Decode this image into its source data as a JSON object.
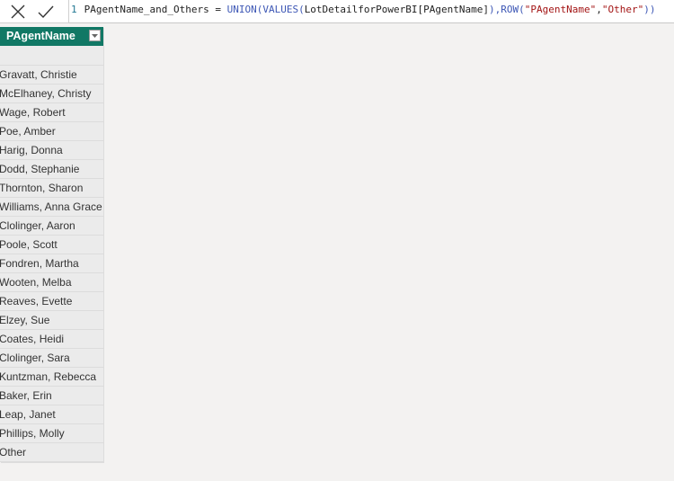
{
  "formula_bar": {
    "cancel_icon": "close-icon",
    "commit_icon": "check-icon",
    "line_number": "1",
    "tokens": [
      {
        "text": "PAgentName_and_Others = ",
        "kind": "plain"
      },
      {
        "text": "UNION(",
        "kind": "kw"
      },
      {
        "text": "VALUES(",
        "kind": "kw"
      },
      {
        "text": "LotDetailforPowerBI[PAgentName]",
        "kind": "plain"
      },
      {
        "text": "),",
        "kind": "kw"
      },
      {
        "text": "ROW(",
        "kind": "kw"
      },
      {
        "text": "\"PAgentName\"",
        "kind": "str"
      },
      {
        "text": ",",
        "kind": "plain"
      },
      {
        "text": "\"Other\"",
        "kind": "str"
      },
      {
        "text": "))",
        "kind": "kw"
      }
    ]
  },
  "table": {
    "header": "PAgentName",
    "header_color": "#117865",
    "filter_icon": "dropdown-filter-icon",
    "rows": [
      "",
      "Gravatt, Christie",
      "McElhaney, Christy",
      "Wage, Robert",
      "Poe, Amber",
      "Harig, Donna",
      "Dodd, Stephanie",
      "Thornton, Sharon",
      "Williams, Anna Grace",
      "Clolinger, Aaron",
      "Poole, Scott",
      "Fondren, Martha",
      "Wooten, Melba",
      "Reaves, Evette",
      "Elzey, Sue",
      "Coates, Heidi",
      "Clolinger, Sara",
      "Kuntzman, Rebecca",
      "Baker, Erin",
      "Leap, Janet",
      "Phillips, Molly",
      "Other"
    ]
  }
}
